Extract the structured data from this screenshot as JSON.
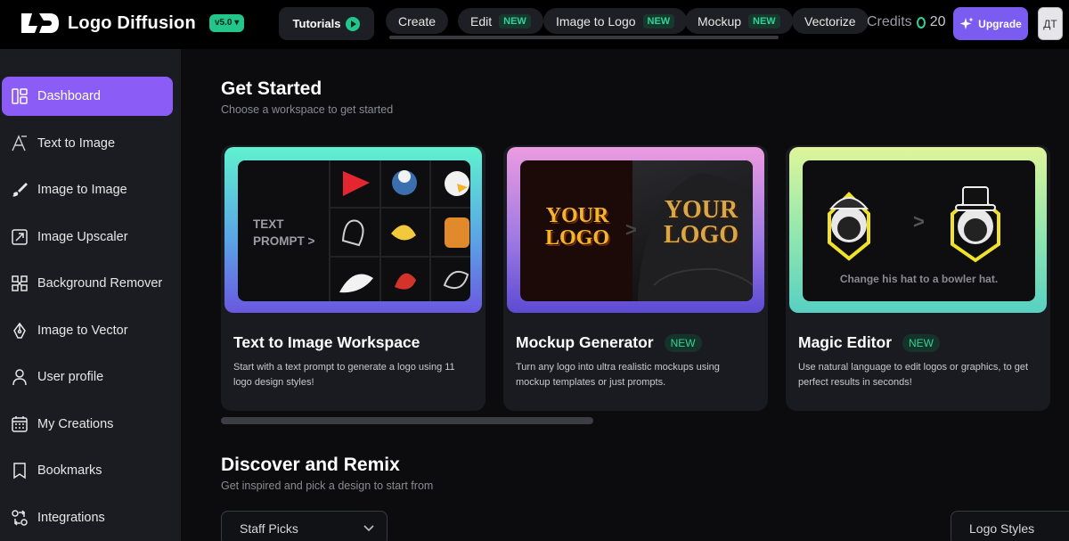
{
  "header": {
    "app_name": "Logo Diffusion",
    "version": "v5.0 ▾",
    "tutorials_label": "Tutorials",
    "nav": [
      {
        "label": "Create",
        "badge": ""
      },
      {
        "label": "Edit",
        "badge": "NEW"
      },
      {
        "label": "Image to Logo",
        "badge": "NEW"
      },
      {
        "label": "Mockup",
        "badge": "NEW"
      },
      {
        "label": "Vectorize",
        "badge": ""
      }
    ],
    "credits_label": "Credits",
    "credits_value": "20",
    "upgrade_label": "Upgrade",
    "avatar_initials": "ДТ"
  },
  "sidebar": {
    "items": [
      {
        "label": "Dashboard",
        "icon": "dashboard-icon",
        "active": true
      },
      {
        "label": "Text to Image",
        "icon": "text-icon"
      },
      {
        "label": "Image to Image",
        "icon": "brush-icon"
      },
      {
        "label": "Image Upscaler",
        "icon": "upscale-icon"
      },
      {
        "label": "Background Remover",
        "icon": "background-remover-icon"
      },
      {
        "label": "Image to Vector",
        "icon": "pen-nib-icon"
      },
      {
        "label": "User profile",
        "icon": "user-icon"
      },
      {
        "label": "My Creations",
        "icon": "calendar-grid-icon"
      },
      {
        "label": "Bookmarks",
        "icon": "bookmark-icon"
      },
      {
        "label": "Integrations",
        "icon": "integrations-icon"
      }
    ]
  },
  "main": {
    "get_started_title": "Get Started",
    "get_started_subtitle": "Choose a workspace to get started",
    "cards": [
      {
        "title": "Text to Image Workspace",
        "badge": "",
        "description": "Start with a text prompt to generate a logo using 11 logo design styles!",
        "art_text": "TEXT PROMPT >"
      },
      {
        "title": "Mockup Generator",
        "badge": "NEW",
        "description": "Turn any logo into ultra realistic mockups using mockup templates or just prompts.",
        "art_text": "YOUR LOGO"
      },
      {
        "title": "Magic Editor",
        "badge": "NEW",
        "description": "Use natural language to edit logos or graphics, to get perfect results in seconds!",
        "art_text": "Change his hat to a bowler hat."
      }
    ],
    "discover_title": "Discover and Remix",
    "discover_subtitle": "Get inspired and pick a design to start from",
    "filter_left": "Staff Picks",
    "filter_right": "Logo Styles"
  },
  "colors": {
    "accent": "#8b5cf6",
    "upgrade": "#7b5cf0",
    "new_badge": "#2fd39a",
    "version_badge": "#22c58b"
  }
}
